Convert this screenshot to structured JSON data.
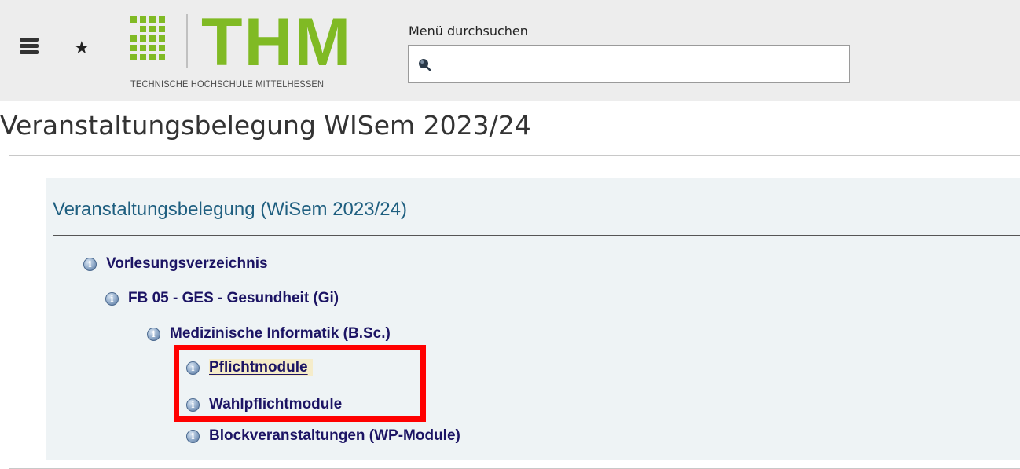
{
  "header": {
    "logo_text": "THM",
    "logo_subtitle": "TECHNISCHE HOCHSCHULE MITTELHESSEN",
    "search_label": "Menü durchsuchen",
    "search_value": "",
    "search_placeholder": ""
  },
  "page_title": "Veranstaltungsbelegung WISem 2023/24",
  "panel": {
    "title": "Veranstaltungsbelegung (WiSem 2023/24)",
    "tree": [
      {
        "label": "Vorlesungsverzeichnis",
        "level": 0
      },
      {
        "label": "FB 05 - GES - Gesundheit (Gi)",
        "level": 1
      },
      {
        "label": "Medizinische Informatik (B.Sc.)",
        "level": 2
      },
      {
        "label": "Pflichtmodule",
        "level": 3,
        "active": true
      },
      {
        "label": "Wahlpflichtmodule",
        "level": 3
      },
      {
        "label": "Blockveranstaltungen (WP-Module)",
        "level": 3
      }
    ]
  },
  "colors": {
    "brand_green": "#80ba24",
    "link": "#1c1464",
    "panel_title": "#1f5f80",
    "highlight": "#ff0000"
  },
  "icons": [
    "menu-icon",
    "star-icon",
    "search-icon",
    "info-icon"
  ]
}
